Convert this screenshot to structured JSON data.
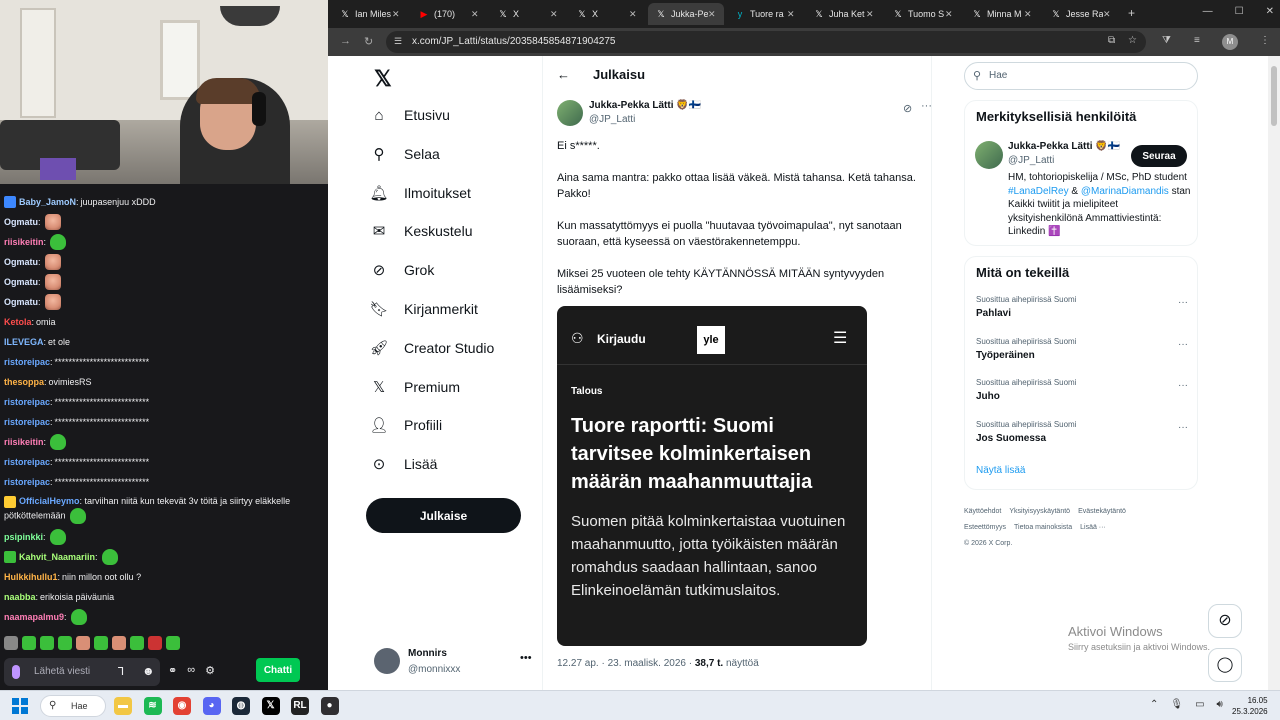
{
  "chat": {
    "messages": [
      {
        "user": "Baby_JamoN",
        "text": "juupasenjuu xDDD",
        "color": "#9ecbff",
        "badge": "#3d88ff",
        "emotes": 0
      },
      {
        "user": "Ogmatu",
        "text": "",
        "color": "#d8e6ff",
        "emotes": 1,
        "emote": "face"
      },
      {
        "user": "riisikeitin",
        "text": "",
        "color": "#ff7eb6",
        "emotes": 1,
        "emote": "frog"
      },
      {
        "user": "Ogmatu",
        "text": "",
        "color": "#d8e6ff",
        "emotes": 1,
        "emote": "face"
      },
      {
        "user": "Ogmatu",
        "text": "",
        "color": "#d8e6ff",
        "emotes": 1,
        "emote": "face"
      },
      {
        "user": "Ogmatu",
        "text": "",
        "color": "#d8e6ff",
        "emotes": 1,
        "emote": "face"
      },
      {
        "user": "Ketola",
        "text": "omia",
        "color": "#ff4d4d",
        "emotes": 0
      },
      {
        "user": "ILEVEGA",
        "text": "et ole",
        "color": "#7fb8ff",
        "emotes": 0
      },
      {
        "user": "ristoreipac",
        "text": "***************************",
        "color": "#6aa8ff",
        "emotes": 0
      },
      {
        "user": "thesoppa",
        "text": "ovimiesRS",
        "color": "#ffb347",
        "emotes": 0
      },
      {
        "user": "ristoreipac",
        "text": "***************************",
        "color": "#6aa8ff",
        "emotes": 0
      },
      {
        "user": "ristoreipac",
        "text": "***************************",
        "color": "#6aa8ff",
        "emotes": 0
      },
      {
        "user": "riisikeitin",
        "text": "",
        "color": "#ff7eb6",
        "emotes": 1,
        "emote": "frog"
      },
      {
        "user": "ristoreipac",
        "text": "***************************",
        "color": "#6aa8ff",
        "emotes": 0
      },
      {
        "user": "ristoreipac",
        "text": "***************************",
        "color": "#6aa8ff",
        "emotes": 0
      }
    ],
    "long_message": {
      "user": "OfficialHeymo",
      "text": "tarviihan niitä kun tekevät 3v töitä ja siirtyy eläkkelle pötköttelemään",
      "color": "#6aa8ff",
      "badge": "#ffcc33"
    },
    "messages2": [
      {
        "user": "psipinkki",
        "text": "",
        "color": "#7fff9a",
        "emotes": 1,
        "emote": "frog"
      },
      {
        "user": "Kahvit_Naamariin",
        "text": "",
        "color": "#a8ff7a",
        "badge": "#3bbf3b",
        "emotes": 1,
        "emote": "frog"
      },
      {
        "user": "Hulkkihullu1",
        "text": "niin millon oot ollu ?",
        "color": "#ffb347",
        "emotes": 0
      },
      {
        "user": "naabba",
        "text": "erikoisia päiväunia",
        "color": "#a8ff7a",
        "emotes": 0
      },
      {
        "user": "naamapalmu9",
        "text": "",
        "color": "#ff7eb6",
        "emotes": 1,
        "emote": "frog"
      }
    ],
    "input_placeholder": "Lähetä viesti",
    "send_label": "Chatti"
  },
  "browser": {
    "tabs": [
      {
        "icon": "𝕏",
        "label": "Ian Miles",
        "active": false
      },
      {
        "icon": "▶",
        "label": "(170)",
        "active": false,
        "icon_color": "#ff0000"
      },
      {
        "icon": "𝕏",
        "label": "X",
        "active": false
      },
      {
        "icon": "𝕏",
        "label": "X",
        "active": false
      },
      {
        "icon": "𝕏",
        "label": "Jukka-Pe",
        "active": true
      },
      {
        "icon": "y",
        "label": "Tuore ra",
        "active": false,
        "icon_color": "#00b4c8"
      },
      {
        "icon": "𝕏",
        "label": "Juha Ket",
        "active": false
      },
      {
        "icon": "𝕏",
        "label": "Tuomo S",
        "active": false
      },
      {
        "icon": "𝕏",
        "label": "Minna M",
        "active": false
      },
      {
        "icon": "𝕏",
        "label": "Jesse Ra",
        "active": false
      }
    ],
    "new_tab": "+",
    "url": "x.com/JP_Latti/status/2035845854871904275",
    "profile_initial": "M"
  },
  "xnav": {
    "logo": "𝕏",
    "items": [
      {
        "icon": "⌂",
        "label": "Etusivu"
      },
      {
        "icon": "⚲",
        "label": "Selaa"
      },
      {
        "icon": "🔔︎",
        "label": "Ilmoitukset"
      },
      {
        "icon": "✉",
        "label": "Keskustelu"
      },
      {
        "icon": "⊘",
        "label": "Grok"
      },
      {
        "icon": "🔖︎",
        "label": "Kirjanmerkit"
      },
      {
        "icon": "🚀︎",
        "label": "Creator Studio"
      },
      {
        "icon": "𝕏",
        "label": "Premium"
      },
      {
        "icon": "👤︎",
        "label": "Profiili"
      },
      {
        "icon": "⊙",
        "label": "Lisää"
      }
    ],
    "post_button": "Julkaise",
    "account": {
      "name": "Monnirs",
      "handle": "@monnixxx",
      "more": "•••"
    }
  },
  "main": {
    "back": "←",
    "title": "Julkaisu",
    "author": {
      "name": "Jukka-Pekka Lätti 🦁🇫🇮",
      "handle": "@JP_Latti"
    },
    "paragraphs": [
      "Ei s*****.",
      "Aina sama mantra: pakko ottaa lisää väkeä. Mistä tahansa. Ketä tahansa. Pakko!",
      "Kun massatyttömyys ei puolla \"huutavaa työvoimapulaa\", nyt sanotaan suoraan, että kyseessä on väestörakennetemppu.",
      "Miksei 25 vuoteen ole tehty KÄYTÄNNÖSSÄ MITÄÄN syntyvyyden lisäämiseksi?"
    ],
    "card": {
      "login": "Kirjaudu",
      "brand": "yle",
      "category": "Talous",
      "headline": "Tuore raportti: Suomi tarvitsee kolminkertaisen määrän maahanmuuttajia",
      "lead": "Suomen pitää kolminkertaistaa vuotuinen maahanmuutto, jotta työikäisten määrän romahdus saadaan hallintaan, sanoo Elinkeinoelämän tutkimuslaitos."
    },
    "meta_time": "12.27 ap. · 23. maalisk. 2026 · ",
    "meta_views": "38,7 t.",
    "meta_views_label": " näyttöä"
  },
  "right": {
    "search_placeholder": "Hae",
    "relevant_title": "Merkityksellisiä henkilöitä",
    "person": {
      "name": "Jukka-Pekka Lätti 🦁🇫🇮",
      "handle": "@JP_Latti",
      "follow": "Seuraa",
      "bio_1": "HM, tohtoriopiskelija / MSc, PhD student ",
      "bio_link1": "#LanaDelRey",
      "bio_2": " & ",
      "bio_link2": "@MarinaDiamandis",
      "bio_3": " stan Kaikki twiitit ja mielipiteet yksityishenkilönä Ammattiviestintä: Linkedin ✝️"
    },
    "trends_title": "Mitä on tekeillä",
    "trends": [
      {
        "context": "Suosittua aihepiirissä Suomi",
        "topic": "Pahlavi"
      },
      {
        "context": "Suosittua aihepiirissä Suomi",
        "topic": "Työperäinen"
      },
      {
        "context": "Suosittua aihepiirissä Suomi",
        "topic": "Juho"
      },
      {
        "context": "Suosittua aihepiirissä Suomi",
        "topic": "Jos Suomessa"
      }
    ],
    "show_more": "Näytä lisää",
    "footer": [
      "Käyttöehdot",
      "Yksityisyyskäytäntö",
      "Evästekäytäntö",
      "Esteettömyys",
      "Tietoa mainoksista",
      "Lisää ···",
      "© 2026 X Corp."
    ]
  },
  "watermark": {
    "title": "Aktivoi Windows",
    "subtitle": "Siirry asetuksiin ja aktivoi Windows."
  },
  "taskbar": {
    "search": "Hae",
    "apps": [
      {
        "name": "file-explorer",
        "glyph": "▬",
        "color": "#f2c744"
      },
      {
        "name": "spotify",
        "glyph": "≋",
        "color": "#1db954"
      },
      {
        "name": "chrome",
        "glyph": "◉",
        "color": "#e34133"
      },
      {
        "name": "discord",
        "glyph": "◕",
        "color": "#5865f2"
      },
      {
        "name": "steam",
        "glyph": "◍",
        "color": "#1b2838"
      },
      {
        "name": "x",
        "glyph": "𝕏",
        "color": "#000000"
      },
      {
        "name": "rl",
        "glyph": "RL",
        "color": "#222222"
      },
      {
        "name": "obs",
        "glyph": "●",
        "color": "#302e31"
      }
    ],
    "time": "16.05",
    "date": "25.3.2026"
  }
}
